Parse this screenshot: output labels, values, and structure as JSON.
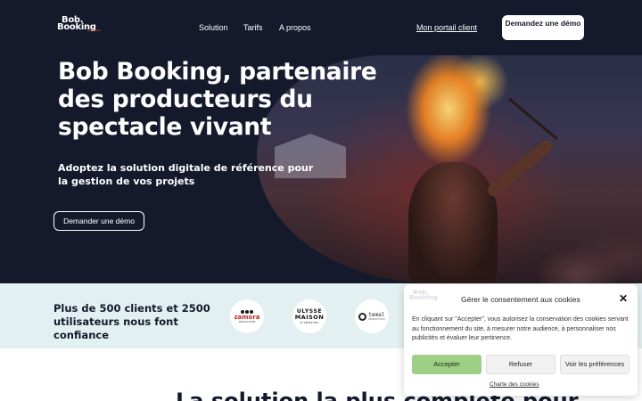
{
  "nav": {
    "logo_line1": "Bob.",
    "logo_line2": "Booking",
    "logo_sub": "by Diapazon",
    "links": [
      "Solution",
      "Tarifs",
      "A propos"
    ],
    "portal_link": "Mon portail client",
    "demo_button": "Demandez une démo"
  },
  "hero": {
    "title": "Bob Booking, partenaire des producteurs du spectacle vivant",
    "subtitle": "Adoptez la solution digitale de référence pour la gestion de vos projets",
    "cta": "Demander une démo"
  },
  "trust": {
    "text": "Plus de 500 clients et 2500 utilisateurs nous font confiance",
    "logos": {
      "zamora": {
        "name": "zamora",
        "tag": "PRODUCTIONS"
      },
      "ulysse": {
        "l1": "ULYSSE",
        "l2": "MAISON",
        "l3": "D'ARTISTES"
      },
      "temal": {
        "name": "temal",
        "tag": "PRODUCTIONS"
      }
    }
  },
  "next_section": {
    "heading": "La solution la plus complète pour"
  },
  "cookie": {
    "logo_line1": "Bob.",
    "logo_line2": "Booking",
    "title": "Gérer le consentement aux cookies",
    "close": "✕",
    "text": "En cliquant sur \"Accepter\", vous autorisez la conservation des cookies servant au fonctionnement du site, à mesurer notre audience, à personnaliser nos publicités et évaluer leur pertinence.",
    "accept": "Accepter",
    "refuse": "Refuser",
    "preferences": "Voir les préférences",
    "policy": "Charte des cookies"
  },
  "colors": {
    "hero_bg": "#141a2c",
    "band_bg": "#e3f0f1",
    "accept_bg": "#9ecf86"
  }
}
